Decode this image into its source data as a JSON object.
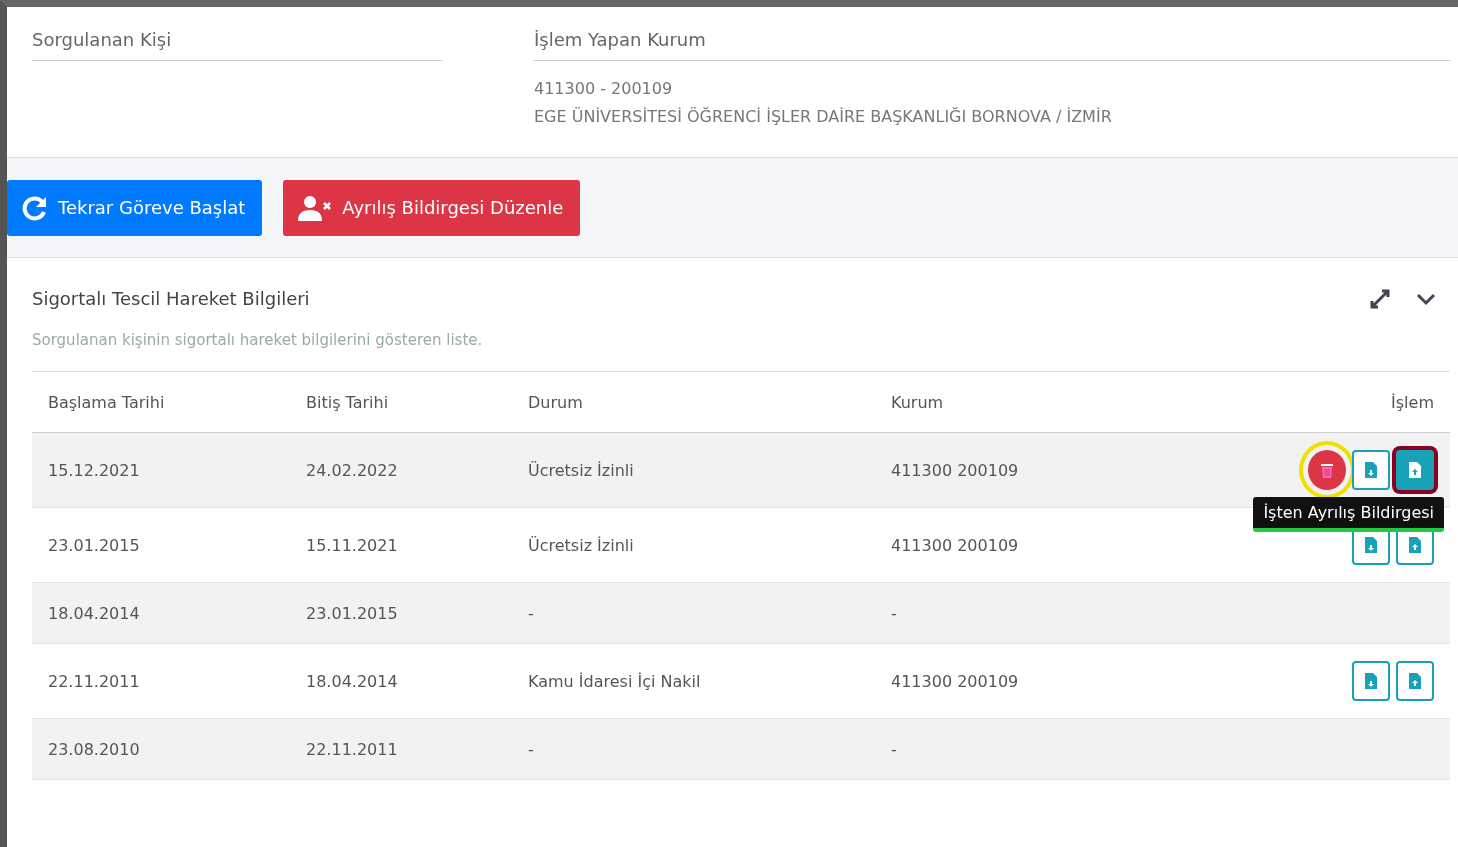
{
  "info": {
    "person_label": "Sorgulanan Kişi",
    "institution_label": "İşlem Yapan Kurum",
    "institution_code": "411300 - 200109",
    "institution_name": "EGE ÜNİVERSİTESİ ÖĞRENCİ İŞLER DAİRE BAŞKANLIĞI BORNOVA / İZMİR"
  },
  "buttons": [
    {
      "kind": "restart",
      "label": "Tekrar Göreve Başlat"
    },
    {
      "kind": "leave",
      "label": "Ayrılış Bildirgesi Düzenle"
    }
  ],
  "card": {
    "title": "Sigortalı Tescil Hareket Bilgileri",
    "subtitle": "Sorgulanan kişinin sigortalı hareket bilgilerini gösteren liste.",
    "columns": [
      "Başlama Tarihi",
      "Bitiş Tarihi",
      "Durum",
      "Kurum",
      "İşlem"
    ],
    "rows": [
      {
        "cells": [
          "15.12.2021",
          "24.02.2022",
          "Ücretsiz İzinli",
          "411300 200109"
        ],
        "actions": [
          {
            "kind": "delete",
            "circled": true,
            "framed": false
          },
          {
            "kind": "download",
            "circled": false,
            "framed": false
          },
          {
            "kind": "upload",
            "circled": false,
            "framed": true
          }
        ],
        "tooltip": {
          "text": "İşten Ayrılış Bildirgesi",
          "underlined": true
        }
      },
      {
        "cells": [
          "23.01.2015",
          "15.11.2021",
          "Ücretsiz İzinli",
          "411300 200109"
        ],
        "actions": [
          {
            "kind": "download",
            "circled": false,
            "framed": false
          },
          {
            "kind": "upload",
            "circled": false,
            "framed": false
          }
        ]
      },
      {
        "cells": [
          "18.04.2014",
          "23.01.2015",
          "-",
          "-"
        ]
      },
      {
        "cells": [
          "22.11.2011",
          "18.04.2014",
          "Kamu İdaresi İçi Nakil",
          "411300 200109"
        ],
        "actions": [
          {
            "kind": "download",
            "circled": false,
            "framed": false
          },
          {
            "kind": "upload",
            "circled": false,
            "framed": false
          }
        ]
      },
      {
        "cells": [
          "23.08.2010",
          "22.11.2011",
          "-",
          "-"
        ]
      }
    ]
  }
}
